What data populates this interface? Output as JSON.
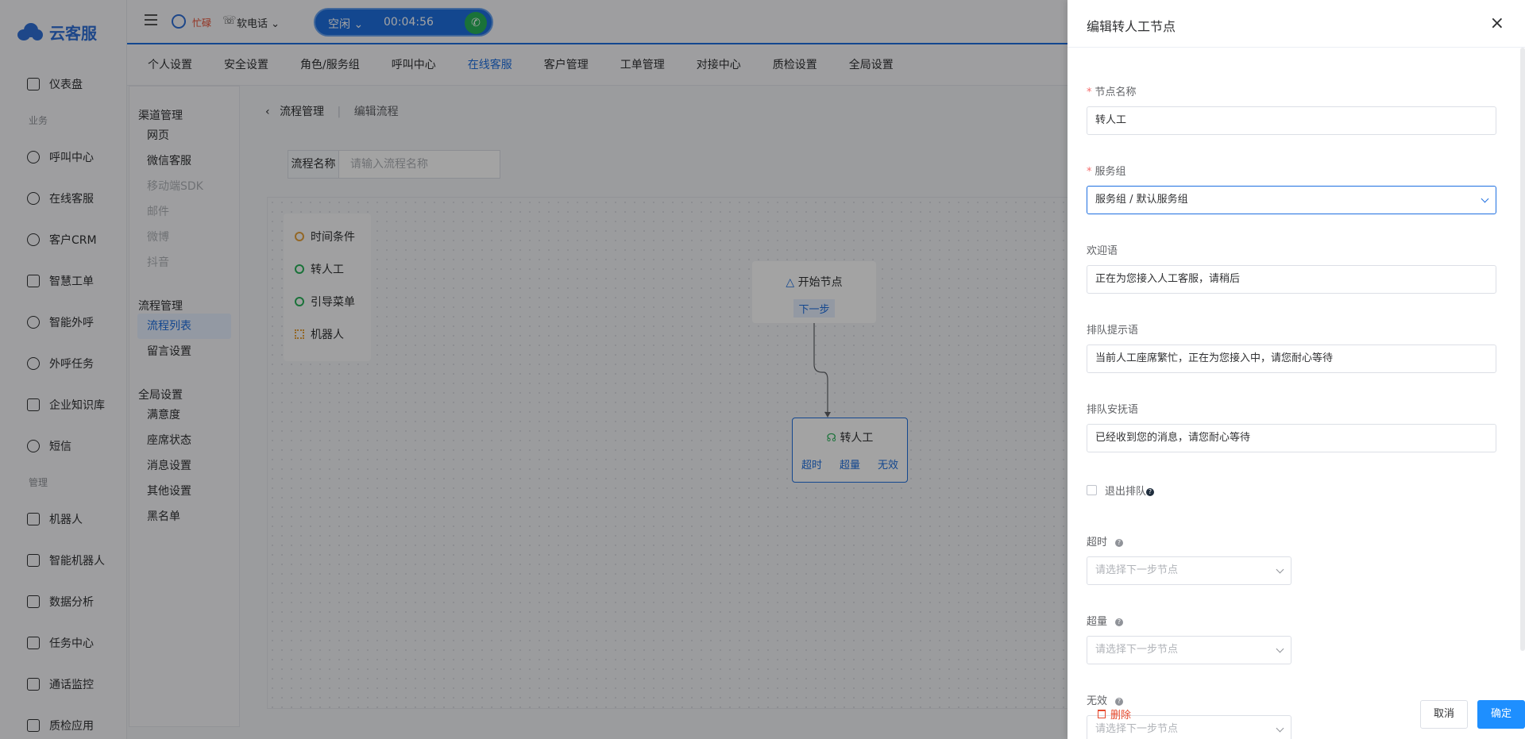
{
  "app": {
    "name": "云客服"
  },
  "sidebar": {
    "items": [
      {
        "label": "仪表盘",
        "icon": "home-icon"
      },
      {
        "group": "业务"
      },
      {
        "label": "呼叫中心",
        "icon": "phone-icon"
      },
      {
        "label": "在线客服",
        "icon": "headset-icon"
      },
      {
        "label": "客户CRM",
        "icon": "user-icon"
      },
      {
        "label": "智慧工单",
        "icon": "document-icon"
      },
      {
        "label": "智能外呼",
        "icon": "chat-phone-icon"
      },
      {
        "label": "外呼任务",
        "icon": "task-phone-icon"
      },
      {
        "label": "企业知识库",
        "icon": "book-icon"
      },
      {
        "label": "短信",
        "icon": "sms-icon"
      },
      {
        "group": "管理"
      },
      {
        "label": "机器人",
        "icon": "robot-icon"
      },
      {
        "label": "智能机器人",
        "icon": "smart-robot-icon"
      },
      {
        "label": "数据分析",
        "icon": "chart-icon"
      },
      {
        "label": "任务中心",
        "icon": "checklist-icon"
      },
      {
        "label": "通话监控",
        "icon": "monitor-icon"
      },
      {
        "label": "质检应用",
        "icon": "inspect-icon"
      }
    ]
  },
  "header": {
    "status": "忙碌",
    "phone_label": "软电话",
    "call_state": "空闲",
    "call_timer": "00:04:56"
  },
  "tabs": [
    {
      "label": "个人设置"
    },
    {
      "label": "安全设置"
    },
    {
      "label": "角色/服务组"
    },
    {
      "label": "呼叫中心"
    },
    {
      "label": "在线客服",
      "active": true
    },
    {
      "label": "客户管理"
    },
    {
      "label": "工单管理"
    },
    {
      "label": "对接中心"
    },
    {
      "label": "质检设置"
    },
    {
      "label": "全局设置"
    }
  ],
  "submenu": {
    "groups": [
      {
        "title": "渠道管理",
        "items": [
          {
            "label": "网页"
          },
          {
            "label": "微信客服"
          },
          {
            "label": "移动端SDK",
            "disabled": true
          },
          {
            "label": "邮件",
            "disabled": true
          },
          {
            "label": "微博",
            "disabled": true
          },
          {
            "label": "抖音",
            "disabled": true
          }
        ]
      },
      {
        "title": "流程管理",
        "items": [
          {
            "label": "流程列表",
            "active": true
          },
          {
            "label": "留言设置"
          }
        ]
      },
      {
        "title": "全局设置",
        "items": [
          {
            "label": "满意度"
          },
          {
            "label": "座席状态"
          },
          {
            "label": "消息设置"
          },
          {
            "label": "其他设置"
          },
          {
            "label": "黑名单"
          }
        ]
      }
    ]
  },
  "breadcrumb": {
    "parent": "流程管理",
    "current": "编辑流程"
  },
  "flow_name": {
    "label": "流程名称",
    "placeholder": "请输入流程名称"
  },
  "palette": [
    {
      "label": "时间条件",
      "color": "#e6a23c"
    },
    {
      "label": "转人工",
      "color": "#29b35a"
    },
    {
      "label": "引导菜单",
      "color": "#29b35a"
    },
    {
      "label": "机器人",
      "color": "#e6a23c"
    }
  ],
  "nodes": {
    "start": {
      "title": "开始节点",
      "next": "下一步"
    },
    "agent": {
      "title": "转人工",
      "outputs": [
        "超时",
        "超量",
        "无效"
      ]
    }
  },
  "drawer": {
    "title": "编辑转人工节点",
    "fields": {
      "node_name": {
        "label": "节点名称",
        "value": "转人工"
      },
      "service_group": {
        "label": "服务组",
        "value": "服务组 / 默认服务组"
      },
      "welcome": {
        "label": "欢迎语",
        "value": "正在为您接入人工客服，请稍后"
      },
      "queue_tip": {
        "label": "排队提示语",
        "value": "当前人工座席繁忙，正在为您接入中，请您耐心等待"
      },
      "queue_soothe": {
        "label": "排队安抚语",
        "value": "已经收到您的消息，请您耐心等待"
      },
      "exit_queue": {
        "label": "退出排队",
        "checked": false
      },
      "timeout": {
        "label": "超时",
        "placeholder": "请选择下一步节点"
      },
      "overflow": {
        "label": "超量",
        "placeholder": "请选择下一步节点"
      },
      "invalid": {
        "label": "无效",
        "placeholder": "请选择下一步节点"
      }
    },
    "delete_label": "删除",
    "cancel_label": "取消",
    "confirm_label": "确定"
  },
  "colors": {
    "primary": "#1e6fe0",
    "danger": "#e6492d",
    "success": "#29b35a"
  }
}
